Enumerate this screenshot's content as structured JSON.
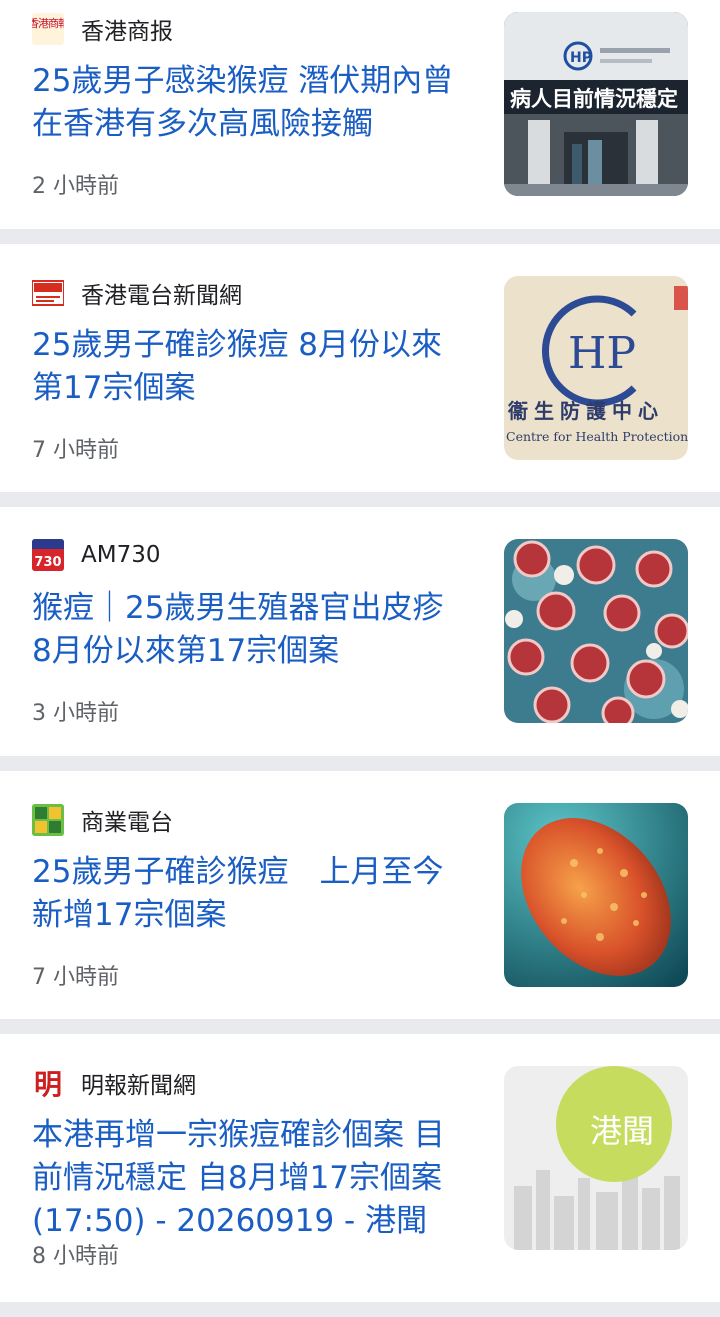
{
  "articles": [
    {
      "source": "香港商报",
      "headline": "25歲男子感染猴痘 潛伏期內曾在香港有多次高風險接觸",
      "time": "2 小時前",
      "logo_color": "#c8102e"
    },
    {
      "source": "香港電台新聞網",
      "headline": "25歲男子確診猴痘 8月份以來第17宗個案",
      "time": "7 小時前",
      "logo_color": "#d62d20"
    },
    {
      "source": "AM730",
      "headline": "猴痘｜25歲男生殖器官出皮疹 8月份以來第17宗個案",
      "time": "3 小時前",
      "logo_color": "#d7262b"
    },
    {
      "source": "商業電台",
      "headline": "25歲男子確診猴痘　上月至今新增17宗個案",
      "time": "7 小時前",
      "logo_color": "#6cbf45"
    },
    {
      "source": "明報新聞網",
      "headline": "本港再增一宗猴痘確診個案 目前情況穩定 自8月增17宗個案 (17:50) - 20260919 - 港聞",
      "time": "8 小時前",
      "logo_color": "#cc1f1f"
    }
  ],
  "images": {
    "chp_building_sign": "病人目前情況穩定",
    "chp_logo_letters": "HP",
    "chp_sign_chinese": "衞生防護中心",
    "chp_sign_english": "Centre for Health Protection",
    "mingpao_section": "港聞"
  },
  "logos": {
    "hkcd": "香港商報",
    "am730": "730",
    "mingpao": "明"
  },
  "colors": {
    "headline": "#1a5ec4",
    "separator": "#e8eaed",
    "meta": "#5f6368"
  }
}
